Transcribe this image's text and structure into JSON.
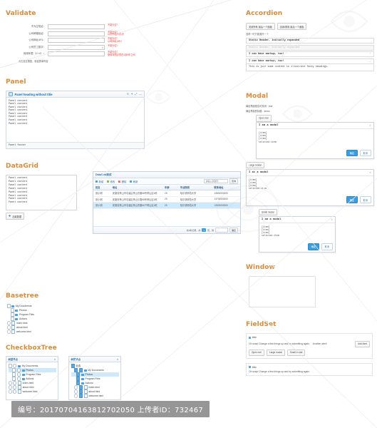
{
  "sections": {
    "validate": "Validate",
    "panel": "Panel",
    "datagrid": "DataGrid",
    "basetree": "Basetree",
    "checkboxtree": "CheckboxTree",
    "accordion": "Accordion",
    "modal": "Modal",
    "window": "Window",
    "fieldset": "FieldSet"
  },
  "colors": {
    "heading": "#d98b3a",
    "primary": "#3b9ddd",
    "error": "#f04040",
    "selection": "#cfe8fa"
  },
  "validate": {
    "rows": [
      {
        "label": "不为空验证：",
        "value": "",
        "errors": [
          "不能为空!"
        ]
      },
      {
        "label": "公司邮箱验证：",
        "value": "",
        "errors": [
          "不能为空!",
          "公司邮箱不合法!"
        ]
      },
      {
        "label": "公司网址URL：",
        "value": "",
        "errors": [
          "不能为空!",
          "公司网址URL!"
        ]
      },
      {
        "label": "公司员工数字：",
        "value": "",
        "spinner": "⇕",
        "errors": [
          "不能为空!"
        ]
      },
      {
        "label": "使用年限（1～6）：",
        "value": "",
        "errors": [
          "不能为空!",
          "使用年限必须在1到6年之间"
        ]
      }
    ],
    "submit_note": "点击提交按钮，验证表单内容"
  },
  "panel": {
    "title": "Panel heading without title",
    "tools": [
      "✕",
      "✦",
      "⤢",
      "—"
    ],
    "content_lines": [
      "Panel content",
      "Panel content",
      "Panel content",
      "Panel content",
      "Panel content",
      "Panel content",
      "Panel content",
      "Panel content"
    ],
    "footer": "Panel footer"
  },
  "datagrid": {
    "left_list": [
      "Panel content",
      "Panel content",
      "Panel content",
      "Panel content",
      "Panel content",
      "Panel content",
      "Panel content",
      "Panel content"
    ],
    "add_button": "加载数据",
    "grid_title": "DataGrid测试",
    "toolbar": [
      "新增",
      "修改",
      "删除",
      "刷新"
    ],
    "search_placeholder": "请输入关键字",
    "search_button": "查询",
    "columns": [
      "姓名",
      "地址",
      "年龄",
      "毕业院校",
      "联系地址"
    ],
    "rows": [
      {
        "name": "张小明",
        "address": "安徽省黄山市屯溪区黄山东路58号黄山区1栋",
        "age": "25",
        "school": "哈尔滨师范大学",
        "contact": "13800000000"
      },
      {
        "name": "张小明",
        "address": "安徽省黄山市屯溪区黄山东路58号黄山区1栋",
        "age": "25",
        "school": "哈尔滨师范大学",
        "contact": "13700000000"
      },
      {
        "name": "张小明",
        "address": "安徽省黄山市屯溪区黄山东路58号黄山区1栋",
        "age": "25",
        "school": "哈尔滨师范大学",
        "contact": "13600000000"
      }
    ],
    "footer": {
      "total_label": "共3条记录，共",
      "current_page": "1",
      "page_label": "页，到",
      "go_button": "确定"
    }
  },
  "basetree": {
    "nodes": [
      {
        "label": "My Documents",
        "type": "folder",
        "indent": 0
      },
      {
        "label": "Photos",
        "type": "folder",
        "indent": 1
      },
      {
        "label": "Program Files",
        "type": "folder",
        "indent": 1
      },
      {
        "label": "Actions",
        "type": "folder",
        "indent": 1
      },
      {
        "label": "index.html",
        "type": "file",
        "indent": 0
      },
      {
        "label": "about.html",
        "type": "file",
        "indent": 0
      },
      {
        "label": "welcome.html",
        "type": "file",
        "indent": 0
      }
    ]
  },
  "checkboxtree": {
    "left": {
      "title": "树型节点",
      "close": "✕",
      "nodes": [
        {
          "label": "My Documents",
          "type": "folder",
          "indent": 0,
          "checked": false,
          "selected": false
        },
        {
          "label": "Photos",
          "type": "folder",
          "indent": 1,
          "checked": true,
          "selected": true
        },
        {
          "label": "Program Files",
          "type": "folder",
          "indent": 1,
          "checked": false,
          "selected": false
        },
        {
          "label": "Actions",
          "type": "folder",
          "indent": 1,
          "checked": false,
          "selected": false
        },
        {
          "label": "index.html",
          "type": "file",
          "indent": 0,
          "checked": false,
          "selected": false
        },
        {
          "label": "about.html",
          "type": "file",
          "indent": 0,
          "checked": false,
          "selected": false
        },
        {
          "label": "welcome.html",
          "type": "file",
          "indent": 0,
          "checked": false,
          "selected": false
        }
      ]
    },
    "right": {
      "title": "树型节点",
      "close": "✕",
      "nodes": [
        {
          "label": "全选",
          "type": "root",
          "indent": 0,
          "checked": true,
          "selected": false
        },
        {
          "label": "My Documents",
          "type": "folder",
          "indent": 1,
          "checked": true,
          "selected": false
        },
        {
          "label": "Photos",
          "type": "folder",
          "indent": 2,
          "checked": true,
          "selected": true
        },
        {
          "label": "Program Files",
          "type": "folder",
          "indent": 2,
          "checked": true,
          "selected": false
        },
        {
          "label": "Actions",
          "type": "folder",
          "indent": 2,
          "checked": true,
          "selected": false
        },
        {
          "label": "index.html",
          "type": "file",
          "indent": 1,
          "checked": true,
          "selected": false
        },
        {
          "label": "about.html",
          "type": "file",
          "indent": 1,
          "checked": true,
          "selected": false
        },
        {
          "label": "welcome.html",
          "type": "file",
          "indent": 1,
          "checked": true,
          "selected": false
        }
      ]
    }
  },
  "accordion": {
    "buttons": [
      "关闭所有 最后一个面板",
      "自用/禁用 最后一个面板"
    ],
    "note": "选项一时只能展开一个",
    "items": [
      {
        "label": "Static Header, initially expanded",
        "state": "plain",
        "caret": ""
      },
      {
        "label": "Static Header, initially expanded",
        "state": "disabled",
        "caret": ""
      },
      {
        "label": "I can have markup, too!",
        "state": "plain",
        "caret": "⌃"
      },
      {
        "label": "I can have markup, too!",
        "state": "plain",
        "caret": "⌄"
      }
    ],
    "content": "This is just some content to illustrate fancy headings."
  },
  "modal": {
    "note1": "弹出界面是否可关闭：true",
    "note2": "弹出界面的标题：demo",
    "open_button": "Open me!",
    "large_button": "Large modal",
    "small_button": "Small modal",
    "dialog": {
      "title": "I am a modal",
      "close": "✕",
      "lines": [
        "[item]",
        "[item]",
        "[item]",
        "selected:item"
      ],
      "ok": "确定",
      "cancel": "取消"
    }
  },
  "fieldset": {
    "first": {
      "legend": "title",
      "message": "Oh snap! Change a few things up and try submitting again.",
      "extra": "Another alert!",
      "add_button": "Add Alert",
      "buttons": [
        "Open me!",
        "Large modal",
        "Small modal"
      ]
    },
    "second": {
      "legend": "title",
      "message": "Oh snap! Change a few things up and try submitting again."
    }
  },
  "footer_bar": "编号：20170704163812702050 上传者ID：732467"
}
